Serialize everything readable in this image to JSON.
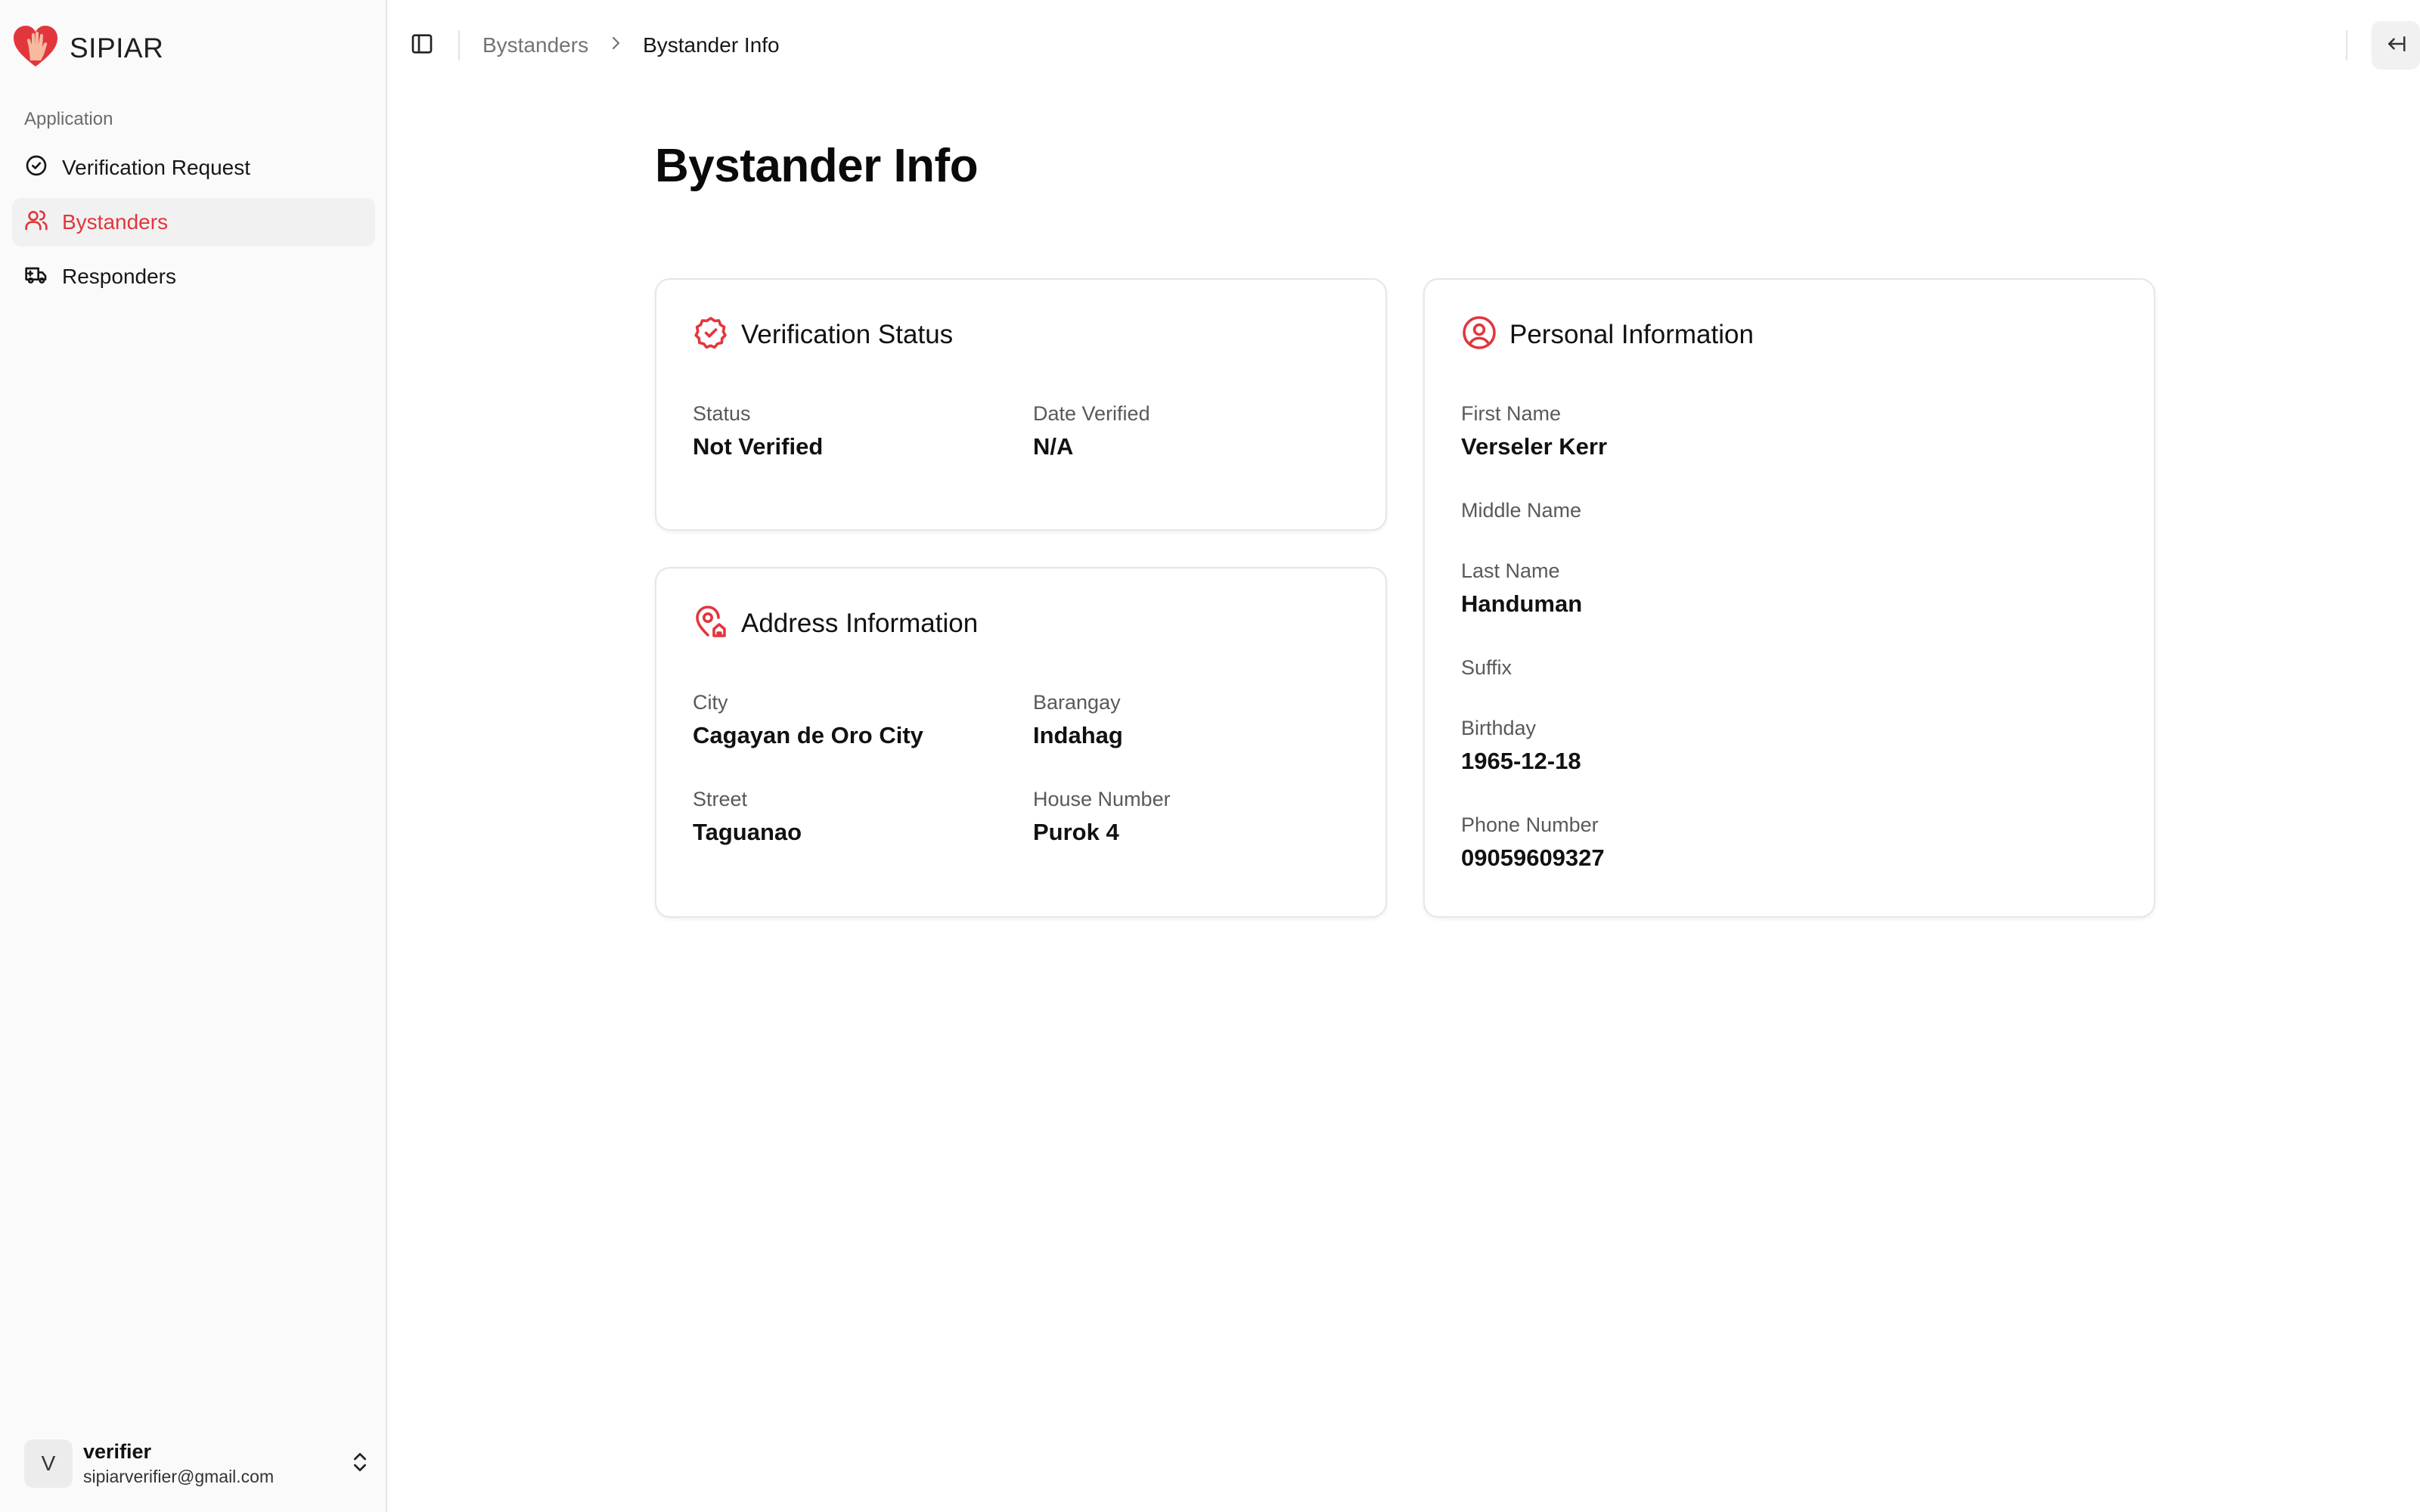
{
  "app": {
    "name": "SIPIAR"
  },
  "sidebar": {
    "section_label": "Application",
    "items": [
      {
        "label": "Verification Request",
        "icon": "circle-check-icon",
        "active": false
      },
      {
        "label": "Bystanders",
        "icon": "users-icon",
        "active": true
      },
      {
        "label": "Responders",
        "icon": "truck-icon",
        "active": false
      }
    ],
    "user": {
      "initial": "V",
      "name": "verifier",
      "email": "sipiarverifier@gmail.com"
    }
  },
  "breadcrumb": {
    "parent": "Bystanders",
    "current": "Bystander Info"
  },
  "page": {
    "title": "Bystander Info"
  },
  "verification": {
    "title": "Verification Status",
    "status_label": "Status",
    "status_value": "Not Verified",
    "date_label": "Date Verified",
    "date_value": "N/A"
  },
  "address": {
    "title": "Address Information",
    "city_label": "City",
    "city_value": "Cagayan de Oro City",
    "barangay_label": "Barangay",
    "barangay_value": "Indahag",
    "street_label": "Street",
    "street_value": "Taguanao",
    "house_label": "House Number",
    "house_value": "Purok 4"
  },
  "personal": {
    "title": "Personal Information",
    "first_label": "First Name",
    "first_value": "Verseler Kerr",
    "middle_label": "Middle Name",
    "middle_value": "",
    "last_label": "Last Name",
    "last_value": "Handuman",
    "suffix_label": "Suffix",
    "suffix_value": "",
    "birthday_label": "Birthday",
    "birthday_value": "1965-12-18",
    "phone_label": "Phone Number",
    "phone_value": "09059609327"
  },
  "colors": {
    "accent": "#e2363d",
    "text": "#0a0a0a",
    "muted": "#737373",
    "border": "#e6e6e6"
  }
}
